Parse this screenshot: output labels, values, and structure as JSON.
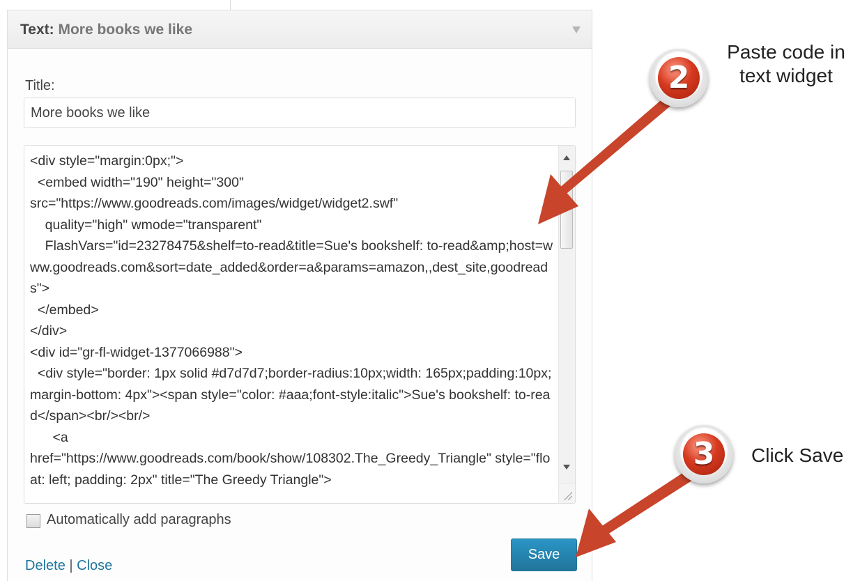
{
  "widget": {
    "header_label": "Text:",
    "header_instance": "More books we like",
    "title_label": "Title:",
    "title_value": "More books we like",
    "code_value": "<div style=\"margin:0px;\">\n  <embed width=\"190\" height=\"300\"\nsrc=\"https://www.goodreads.com/images/widget/widget2.swf\"\n    quality=\"high\" wmode=\"transparent\"\n    FlashVars=\"id=23278475&shelf=to-read&title=Sue's bookshelf: to-read&amp;host=www.goodreads.com&sort=date_added&order=a&params=amazon,,dest_site,goodreads\">\n  </embed>\n</div>\n<div id=\"gr-fl-widget-1377066988\">\n  <div style=\"border: 1px solid #d7d7d7;border-radius:10px;width: 165px;padding:10px; margin-bottom: 4px\"><span style=\"color: #aaa;font-style:italic\">Sue's bookshelf: to-read</span><br/><br/>\n      <a\nhref=\"https://www.goodreads.com/book/show/108302.The_Greedy_Triangle\" style=\"float: left; padding: 2px\" title=\"The Greedy Triangle\">",
    "autop_label": "Automatically add paragraphs",
    "autop_checked": false,
    "delete_label": "Delete",
    "separator": "|",
    "close_label": "Close",
    "save_label": "Save"
  },
  "annotations": [
    {
      "number": "2",
      "text": "Paste code in\ntext widget"
    },
    {
      "number": "3",
      "text": "Click Save"
    }
  ],
  "colors": {
    "link": "#21759b",
    "save_button": "#2a95c5",
    "arrow": "#c8442a",
    "badge": "#d63a1f"
  },
  "icons": [
    "chevron-down-icon",
    "checkbox-icon",
    "resize-grip-icon",
    "arrow-icon"
  ]
}
